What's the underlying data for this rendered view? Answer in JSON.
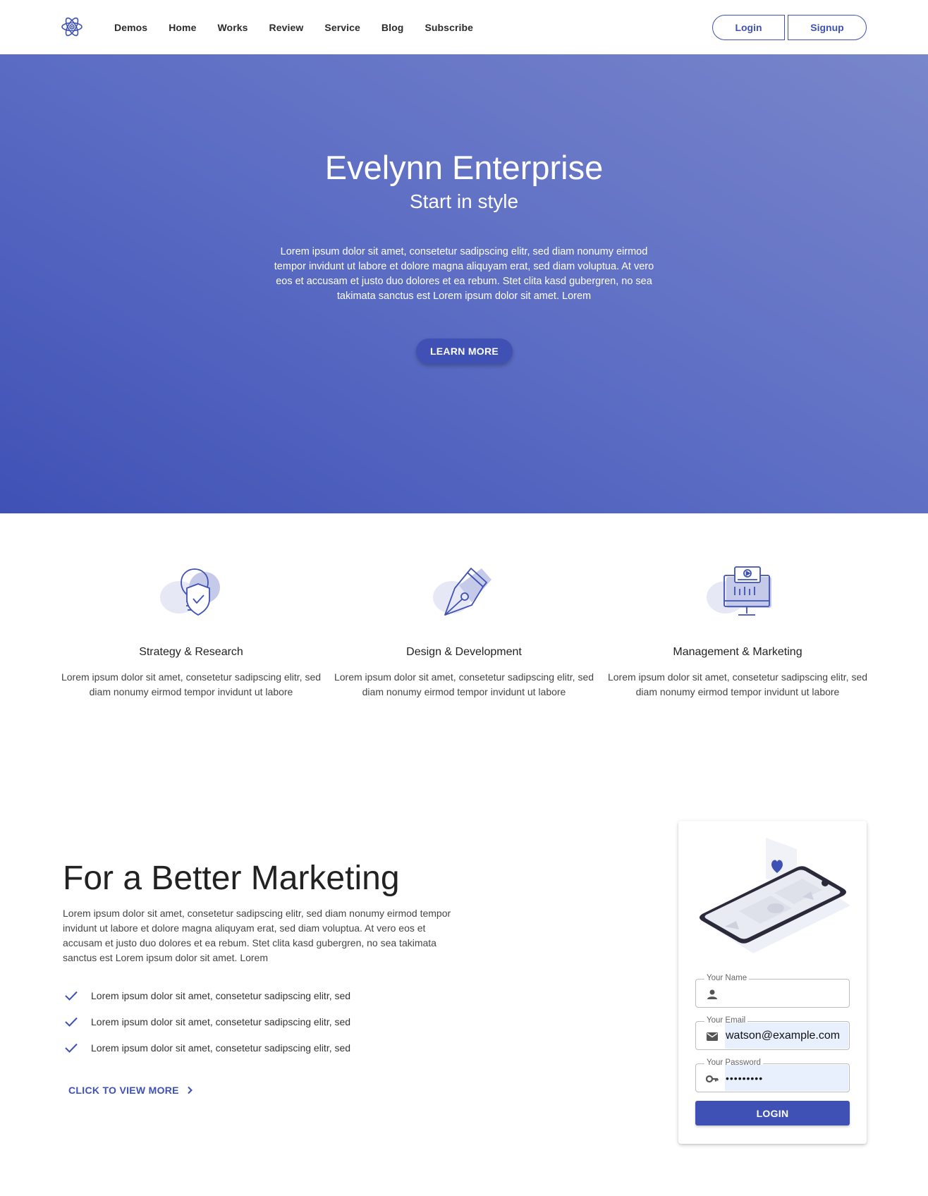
{
  "nav": {
    "logo_icon": "atom-icon",
    "links": [
      "Demos",
      "Home",
      "Works",
      "Review",
      "Service",
      "Blog",
      "Subscribe"
    ],
    "login_label": "Login",
    "signup_label": "Signup"
  },
  "hero": {
    "title": "Evelynn Enterprise",
    "subtitle": "Start in style",
    "text": "Lorem ipsum dolor sit amet, consetetur sadipscing elitr, sed diam nonumy eirmod tempor invidunt ut labore et dolore magna aliquyam erat, sed diam voluptua. At vero eos et accusam et justo duo dolores et ea rebum. Stet clita kasd gubergren, no sea takimata sanctus est Lorem ipsum dolor sit amet. Lorem",
    "button_label": "LEARN MORE"
  },
  "features": [
    {
      "icon": "bulb-shield-icon",
      "title": "Strategy & Research",
      "text": "Lorem ipsum dolor sit amet, consetetur sadipscing elitr, sed diam nonumy eirmod tempor invidunt ut labore"
    },
    {
      "icon": "pen-nib-icon",
      "title": "Design & Development",
      "text": "Lorem ipsum dolor sit amet, consetetur sadipscing elitr, sed diam nonumy eirmod tempor invidunt ut labore"
    },
    {
      "icon": "monitor-video-icon",
      "title": "Management & Marketing",
      "text": "Lorem ipsum dolor sit amet, consetetur sadipscing elitr, sed diam nonumy eirmod tempor invidunt ut labore"
    }
  ],
  "marketing": {
    "title": "For a Better Marketing",
    "text": "Lorem ipsum dolor sit amet, consetetur sadipscing elitr, sed diam nonumy eirmod tempor invidunt ut labore et dolore magna aliquyam erat, sed diam voluptua. At vero eos et accusam et justo duo dolores et ea rebum. Stet clita kasd gubergren, no sea takimata sanctus est Lorem ipsum dolor sit amet. Lorem",
    "checklist": [
      "Lorem ipsum dolor sit amet, consetetur sadipscing elitr, sed",
      "Lorem ipsum dolor sit amet, consetetur sadipscing elitr, sed",
      "Lorem ipsum dolor sit amet, consetetur sadipscing elitr, sed"
    ],
    "view_more_label": "CLICK TO VIEW MORE"
  },
  "login_form": {
    "name_label": "Your Name",
    "name_value": "",
    "email_label": "Your Email",
    "email_value": "watson@example.com",
    "password_label": "Your Password",
    "password_value": "•••••••••",
    "button_label": "LOGIN"
  },
  "colors": {
    "primary": "#3f51b5",
    "hero_gradient_start": "#3f51b5",
    "hero_gradient_end": "#7986cb",
    "autofill": "#e8f0fe"
  }
}
